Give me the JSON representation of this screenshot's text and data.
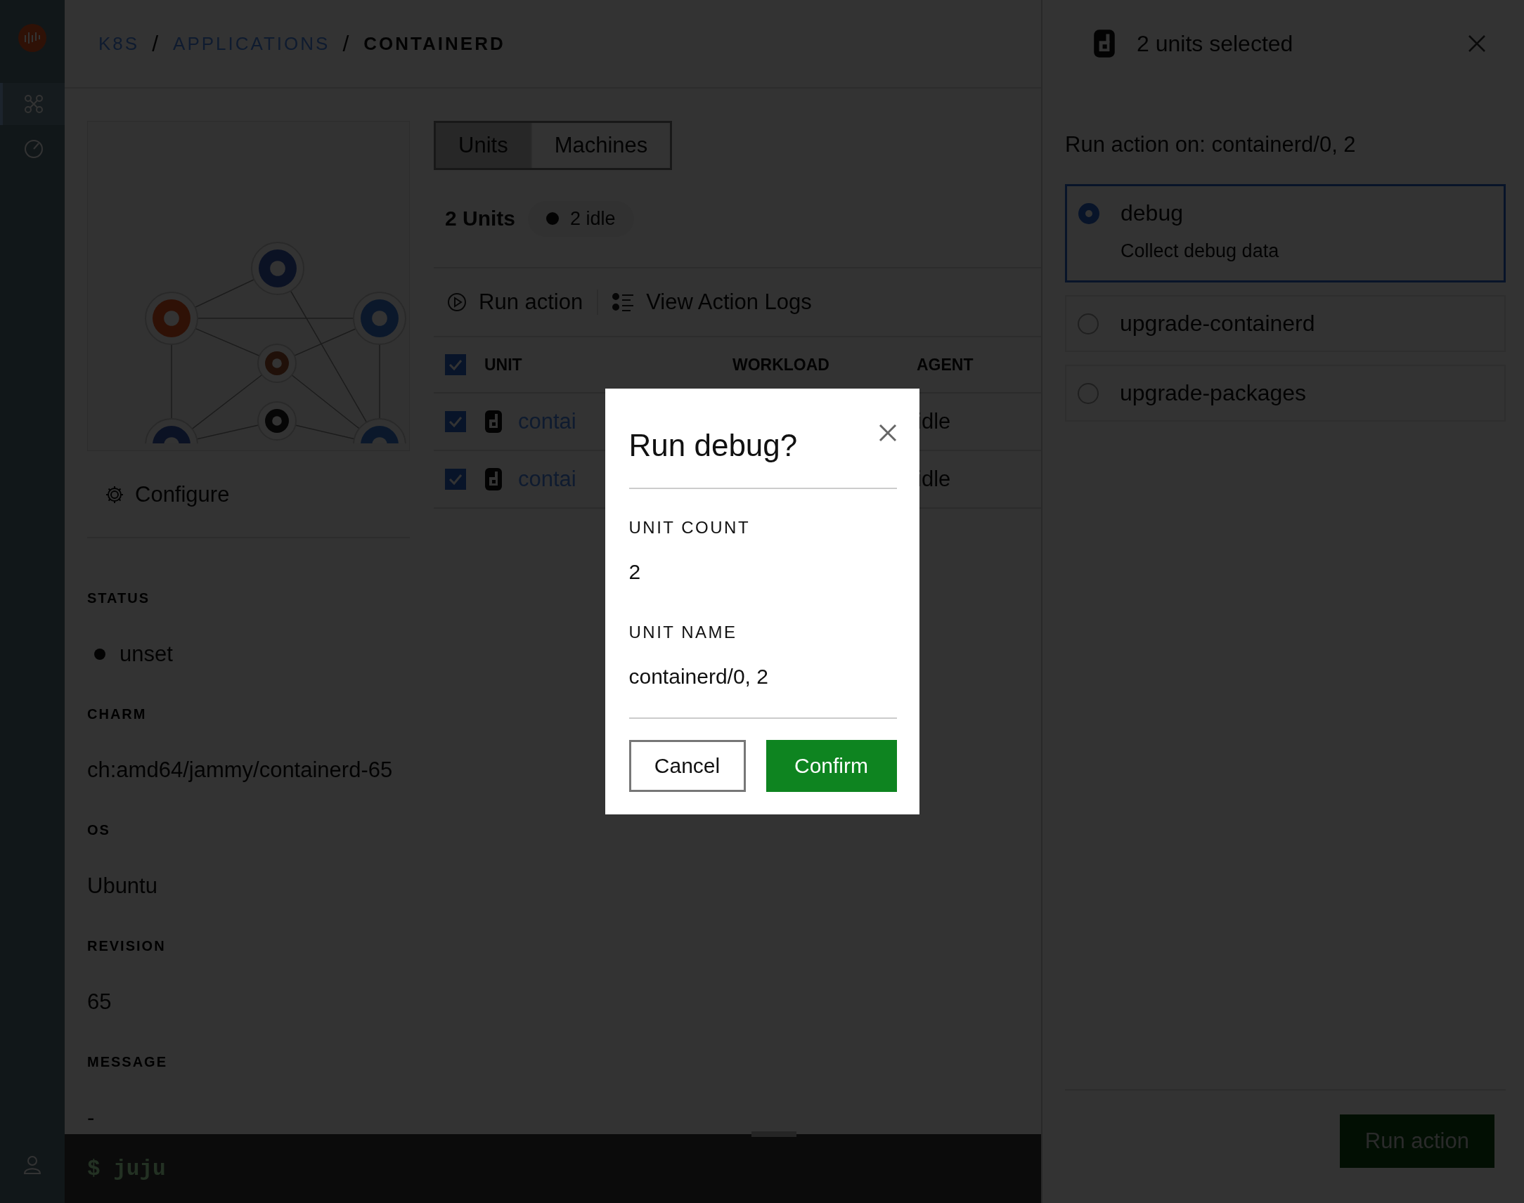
{
  "sidebar": {
    "items": [
      {
        "kind": "graph",
        "selected": true
      },
      {
        "kind": "gauge",
        "selected": false
      }
    ]
  },
  "breadcrumb": [
    {
      "label": "K8S",
      "kind": "link"
    },
    {
      "label": "/",
      "kind": "separator"
    },
    {
      "label": "APPLICATIONS",
      "kind": "link"
    },
    {
      "label": "/",
      "kind": "separator"
    },
    {
      "label": "CONTAINERD",
      "kind": "current"
    }
  ],
  "details": {
    "configure": "Configure",
    "fields": [
      {
        "label": "STATUS",
        "value": "unset",
        "kind": "status"
      },
      {
        "label": "CHARM",
        "value": "ch:amd64/jammy/containerd-65",
        "kind": "text"
      },
      {
        "label": "OS",
        "value": "Ubuntu",
        "kind": "text"
      },
      {
        "label": "REVISION",
        "value": "65",
        "kind": "text"
      },
      {
        "label": "MESSAGE",
        "value": "-",
        "kind": "text"
      }
    ]
  },
  "tabs": [
    {
      "label": "Units",
      "selected": true
    },
    {
      "label": "Machines",
      "selected": false
    }
  ],
  "units_summary": {
    "title": "2 Units",
    "chip": "2 idle"
  },
  "actions": [
    {
      "label": "Run action",
      "kind": "play"
    },
    {
      "label": "View Action Logs",
      "kind": "list"
    }
  ],
  "table": {
    "all_checked": true,
    "columns": [
      "UNIT",
      "WORKLOAD",
      "AGENT"
    ],
    "rows": [
      {
        "checked": true,
        "unit": "contai",
        "agent": "idle"
      },
      {
        "checked": true,
        "unit": "contai",
        "agent": "idle"
      }
    ]
  },
  "terminal": {
    "prompt": "$ juju"
  },
  "panel": {
    "title": "2 units selected",
    "subtitle": "Run action on: containerd/0, 2",
    "options": [
      {
        "name": "debug",
        "description": "Collect debug data",
        "selected": true
      },
      {
        "name": "upgrade-containerd",
        "selected": false
      },
      {
        "name": "upgrade-packages",
        "selected": false
      }
    ],
    "submit": {
      "label": "Run action",
      "disabled": true
    }
  },
  "modal": {
    "title": "Run debug?",
    "fields": [
      {
        "label": "UNIT COUNT",
        "value": "2"
      },
      {
        "label": "UNIT NAME",
        "value": "containerd/0, 2"
      }
    ],
    "buttons": [
      {
        "label": "Cancel",
        "kind": "secondary"
      },
      {
        "label": "Confirm",
        "kind": "primary"
      }
    ]
  }
}
